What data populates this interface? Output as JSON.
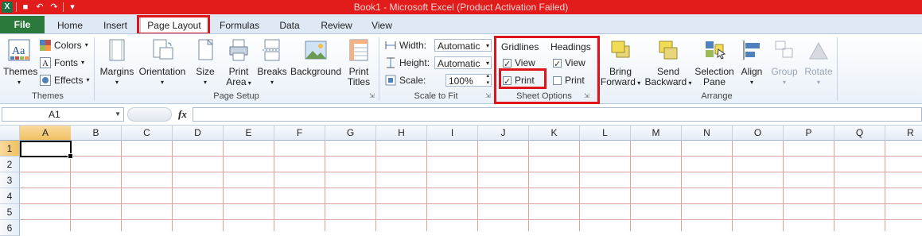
{
  "window": {
    "title": "Book1  -  Microsoft Excel (Product Activation Failed)"
  },
  "tabs": {
    "file": "File",
    "home": "Home",
    "insert": "Insert",
    "page_layout": "Page Layout",
    "formulas": "Formulas",
    "data": "Data",
    "review": "Review",
    "view": "View"
  },
  "ribbon": {
    "themes_group": {
      "label": "Themes",
      "themes": "Themes",
      "colors": "Colors",
      "fonts": "Fonts",
      "effects": "Effects"
    },
    "page_setup_group": {
      "label": "Page Setup",
      "margins": "Margins",
      "orientation": "Orientation",
      "size": "Size",
      "print_area_1": "Print",
      "print_area_2": "Area",
      "breaks": "Breaks",
      "background": "Background",
      "print_titles_1": "Print",
      "print_titles_2": "Titles"
    },
    "scale_group": {
      "label": "Scale to Fit",
      "width_label": "Width:",
      "width_value": "Automatic",
      "height_label": "Height:",
      "height_value": "Automatic",
      "scale_label": "Scale:",
      "scale_value": "100%"
    },
    "sheet_options_group": {
      "label": "Sheet Options",
      "gridlines": "Gridlines",
      "headings": "Headings",
      "view": "View",
      "print": "Print",
      "gridlines_view_checked": true,
      "gridlines_print_checked": true,
      "headings_view_checked": true,
      "headings_print_checked": false
    },
    "arrange_group": {
      "label": "Arrange",
      "bring_forward_1": "Bring",
      "bring_forward_2": "Forward",
      "send_backward_1": "Send",
      "send_backward_2": "Backward",
      "selection_pane_1": "Selection",
      "selection_pane_2": "Pane",
      "align": "Align",
      "group": "Group",
      "rotate": "Rotate"
    }
  },
  "formula_bar": {
    "name_box": "A1",
    "fx": "fx",
    "formula": ""
  },
  "sheet": {
    "columns": [
      "A",
      "B",
      "C",
      "D",
      "E",
      "F",
      "G",
      "H",
      "I",
      "J",
      "K",
      "L",
      "M",
      "N",
      "O",
      "P",
      "Q",
      "R"
    ],
    "rows": [
      "1",
      "2",
      "3",
      "4",
      "5",
      "6"
    ],
    "active_cell": "A1"
  },
  "colors": {
    "title_bar": "#e21b1b",
    "file_tab": "#2a7a3b",
    "highlight_box": "#e0141b"
  }
}
